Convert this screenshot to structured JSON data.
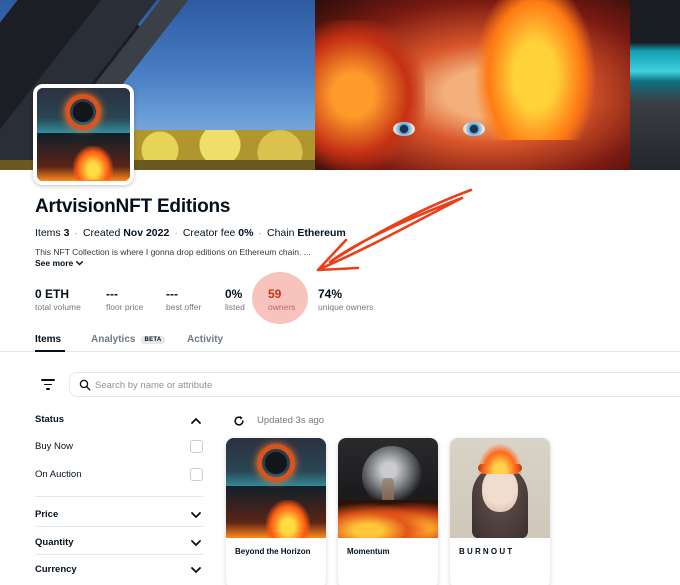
{
  "collection": {
    "name": "ArtvisionNFT Editions",
    "meta": {
      "items_label": "Items",
      "items_value": "3",
      "created_label": "Created",
      "created_value": "Nov 2022",
      "fee_label": "Creator fee",
      "fee_value": "0%",
      "chain_label": "Chain",
      "chain_value": "Ethereum"
    },
    "description": "This NFT Collection is where I gonna drop editions on Ethereum chain. ...",
    "see_more": "See more"
  },
  "stats": [
    {
      "value": "0 ETH",
      "label": "total volume"
    },
    {
      "value": "---",
      "label": "floor price"
    },
    {
      "value": "---",
      "label": "best offer"
    },
    {
      "value": "0%",
      "label": "listed"
    },
    {
      "value": "59",
      "label": "owners"
    },
    {
      "value": "74%",
      "label": "unique owners"
    }
  ],
  "tabs": [
    {
      "label": "Items",
      "active": true
    },
    {
      "label": "Analytics",
      "badge": "BETA"
    },
    {
      "label": "Activity"
    }
  ],
  "search": {
    "placeholder": "Search by name or attribute"
  },
  "sidebar": {
    "status": {
      "title": "Status",
      "options": [
        "Buy Now",
        "On Auction"
      ]
    },
    "sections": [
      "Price",
      "Quantity",
      "Currency"
    ]
  },
  "grid": {
    "updated": "Updated 3s ago",
    "items": [
      {
        "name": "Beyond the Horizon"
      },
      {
        "name": "Momentum"
      },
      {
        "name": "BURNOUT"
      }
    ]
  },
  "colors": {
    "text": "#04111d",
    "muted": "#707a83",
    "annotation": "#e8401c",
    "highlight": "#f6b9b0"
  },
  "icons": [
    "filter-icon",
    "search-icon",
    "refresh-icon",
    "chevron-up-icon",
    "chevron-down-icon"
  ]
}
